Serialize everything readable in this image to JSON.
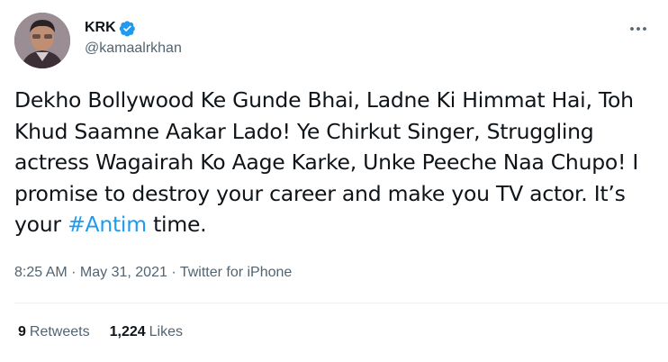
{
  "user": {
    "display_name": "KRK",
    "handle": "@kamaalrkhan",
    "verified": true,
    "avatar_icon": "avatar-photo"
  },
  "tweet": {
    "text_before_hashtag": "Dekho Bollywood Ke Gunde Bhai, Ladne Ki Himmat Hai, Toh Khud Saamne Aakar Lado! Ye Chirkut Singer, Struggling actress Wagairah Ko Aage Karke, Unke Peeche Naa Chupo! I promise to destroy your career and make you TV actor. It’s your ",
    "hashtag": "#Antim",
    "text_after_hashtag": " time."
  },
  "meta": {
    "time": "8:25 AM",
    "separator": " · ",
    "date": "May 31, 2021",
    "source": "Twitter for iPhone"
  },
  "stats": {
    "retweets_count": "9",
    "retweets_label": "Retweets",
    "likes_count": "1,224",
    "likes_label": "Likes"
  },
  "colors": {
    "accent": "#1d9bf0",
    "text_primary": "#0f1419",
    "text_secondary": "#536471",
    "divider": "#eff3f4"
  },
  "icons": {
    "verified": "verified-badge-icon",
    "more": "more-options-icon"
  }
}
